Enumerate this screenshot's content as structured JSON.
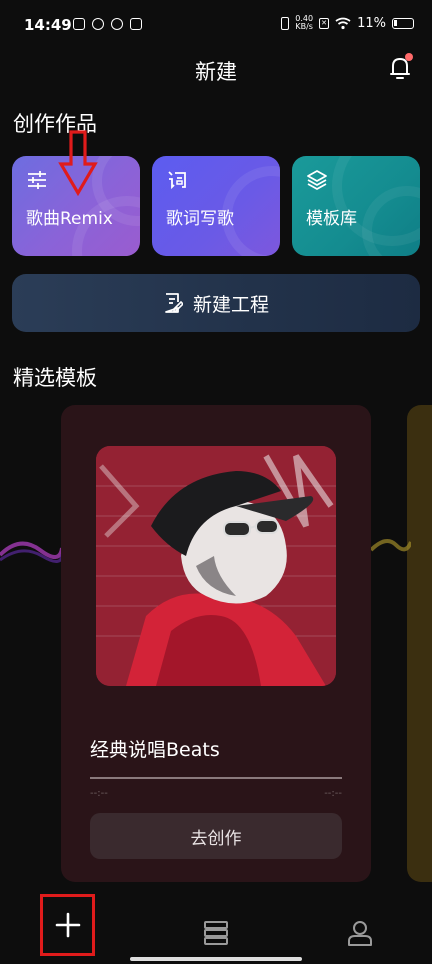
{
  "status_bar": {
    "time": "14:49",
    "net_speed_top": "0.40",
    "net_speed_bottom": "KB/s",
    "battery": "11%"
  },
  "header": {
    "title": "新建",
    "bell_icon": "bell-icon"
  },
  "create": {
    "section_title": "创作作品",
    "cards": [
      {
        "label": "歌曲Remix",
        "icon": "sliders-icon"
      },
      {
        "label": "歌词写歌",
        "icon": "lyrics-icon"
      },
      {
        "label": "模板库",
        "icon": "layers-icon"
      }
    ],
    "new_project_label": "新建工程",
    "new_project_icon": "document-edit-icon"
  },
  "templates": {
    "section_title": "精选模板",
    "featured": {
      "name": "经典说唱Beats",
      "time_start": "--:--",
      "time_end": "--:--",
      "button_label": "去创作",
      "progress": 0
    }
  },
  "bottom_nav": {
    "items": [
      {
        "icon": "plus-icon"
      },
      {
        "icon": "list-icon"
      },
      {
        "icon": "profile-icon"
      }
    ]
  },
  "colors": {
    "annotation": "#e01b1b",
    "remix_card": "#7e66dc",
    "lyrics_card": "#6259ec",
    "template_card": "#16908f",
    "new_project": "#26374f"
  }
}
